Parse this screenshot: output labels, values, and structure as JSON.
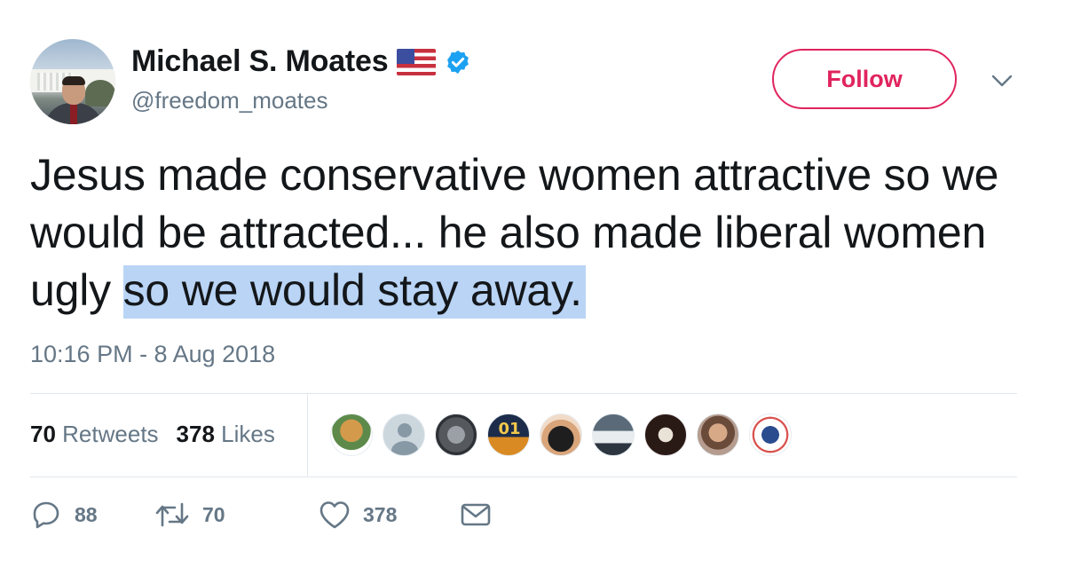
{
  "user": {
    "display_name": "Michael S. Moates",
    "handle": "@freedom_moates"
  },
  "follow_label": "Follow",
  "tweet": {
    "text_plain": "Jesus made conservative women attractive so we would be attracted... he also made liberal women ugly ",
    "text_highlighted": "so we would stay away.",
    "timestamp": "10:16 PM - 8 Aug 2018"
  },
  "stats": {
    "retweets_count": "70",
    "retweets_label": "Retweets",
    "likes_count": "378",
    "likes_label": "Likes"
  },
  "likers": {
    "avatar_4_text": "01"
  },
  "actions": {
    "reply_count": "88",
    "retweet_count": "70",
    "like_count": "378"
  },
  "colors": {
    "follow_accent": "#e0245e",
    "verified_badge": "#1da1f2",
    "highlight": "#b9d4f5",
    "secondary_text": "#657786"
  },
  "icons": [
    "verified-badge-icon",
    "us-flag-icon",
    "chevron-down-icon",
    "reply-icon",
    "retweet-icon",
    "heart-icon",
    "envelope-icon"
  ]
}
